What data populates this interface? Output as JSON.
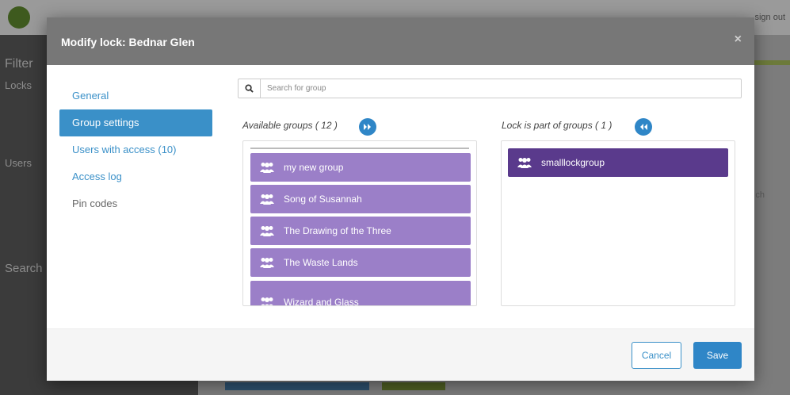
{
  "background": {
    "top_right_text": "sign out",
    "sidebar_headings": [
      "Filter",
      "Locks",
      "Users",
      "Search"
    ],
    "right_side_text": "ch"
  },
  "modal": {
    "title": "Modify lock: Bednar Glen",
    "close_label": "×"
  },
  "nav": {
    "items": [
      {
        "label": "General"
      },
      {
        "label": "Group settings"
      },
      {
        "label": "Users with access (10)"
      },
      {
        "label": "Access log"
      },
      {
        "label": "Pin codes"
      }
    ],
    "active_index": 1
  },
  "search": {
    "placeholder": "Search for group"
  },
  "available": {
    "title": "Available groups ( 12 )",
    "move_all_icon": "double-chevron-right",
    "groups": [
      {
        "label": "my new group"
      },
      {
        "label": "Song of Susannah"
      },
      {
        "label": "The Drawing of the Three"
      },
      {
        "label": "The Waste Lands"
      },
      {
        "label": "Wizard and Glass"
      }
    ]
  },
  "member_of": {
    "title": "Lock is part of groups ( 1 )",
    "move_all_icon": "double-chevron-left",
    "groups": [
      {
        "label": "smalllockgroup"
      }
    ]
  },
  "footer": {
    "cancel_label": "Cancel",
    "save_label": "Save"
  },
  "colors": {
    "accent": "#2f86c7",
    "available_group": "#9b7fc8",
    "member_group": "#5a3a8c",
    "header": "#777777"
  }
}
